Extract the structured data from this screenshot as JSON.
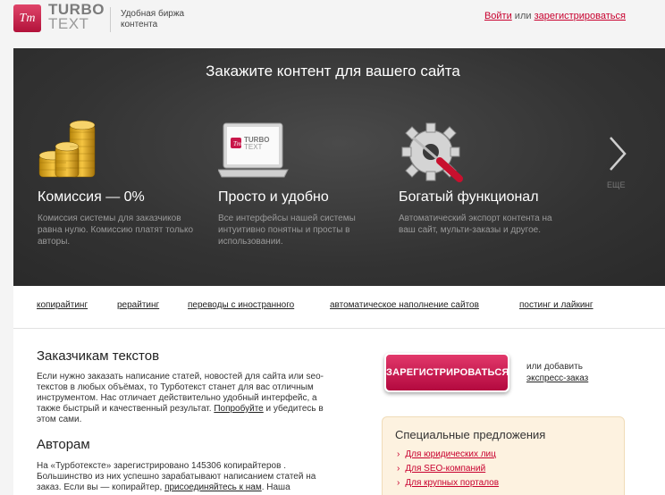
{
  "header": {
    "logo_mark": "Tт",
    "logo_line1": "TURBO",
    "logo_line2": "TEXT",
    "tagline": "Удобная биржа контента",
    "login": "Войти",
    "or": "или",
    "register": "зарегистрироваться"
  },
  "hero": {
    "title": "Закажите контент для вашего сайта",
    "more": "ЕЩЕ",
    "features": [
      {
        "title": "Комиссия — 0%",
        "desc": "Комиссия системы для заказчиков равна нулю. Комиссию платят только авторы.",
        "icon": "coins-icon"
      },
      {
        "title": "Просто и удобно",
        "desc": "Все интерфейсы нашей системы интуитивно понятны и просты в использовании.",
        "icon": "laptop-icon"
      },
      {
        "title": "Богатый функционал",
        "desc": "Автоматический экспорт контента на ваш сайт, мульти-заказы и другое.",
        "icon": "gear-screwdriver-icon"
      }
    ]
  },
  "nav": [
    "копирайтинг",
    "рерайтинг",
    "переводы с иностранного",
    "автоматическое наполнение сайтов",
    "постинг и лайкинг"
  ],
  "customers": {
    "title": "Заказчикам текстов",
    "text": "Если нужно заказать написание статей, новостей для сайта или seo-текстов в любых объёмах, то Турботекст станет для вас отличным инструментом. Нас отличает действительно удобный интерфейс, а также быстрый и качественный результат.",
    "try_link": "Попробуйте",
    "try_rest": " и убедитесь в этом сами."
  },
  "authors": {
    "title": "Авторам",
    "text": "На «Турботексте» зарегистрировано 145306 копирайтеров . Большинство из них успешно зарабатывают написанием статей на заказ. Если вы — копирайтер, ",
    "join_link": "присоединяйтесь к нам",
    "text_end": ". Наша"
  },
  "cta": {
    "button": "ЗАРЕГИСТРИРОВАТЬСЯ",
    "or_add": "или добавить",
    "express": "экспресс-заказ"
  },
  "special": {
    "title": "Специальные предложения",
    "items": [
      "Для юридических лиц",
      "Для SEO-компаний",
      "Для крупных порталов"
    ]
  },
  "colors": {
    "accent": "#c8002e",
    "hero_bg": "#333333",
    "special_bg": "#fdf2e0"
  }
}
